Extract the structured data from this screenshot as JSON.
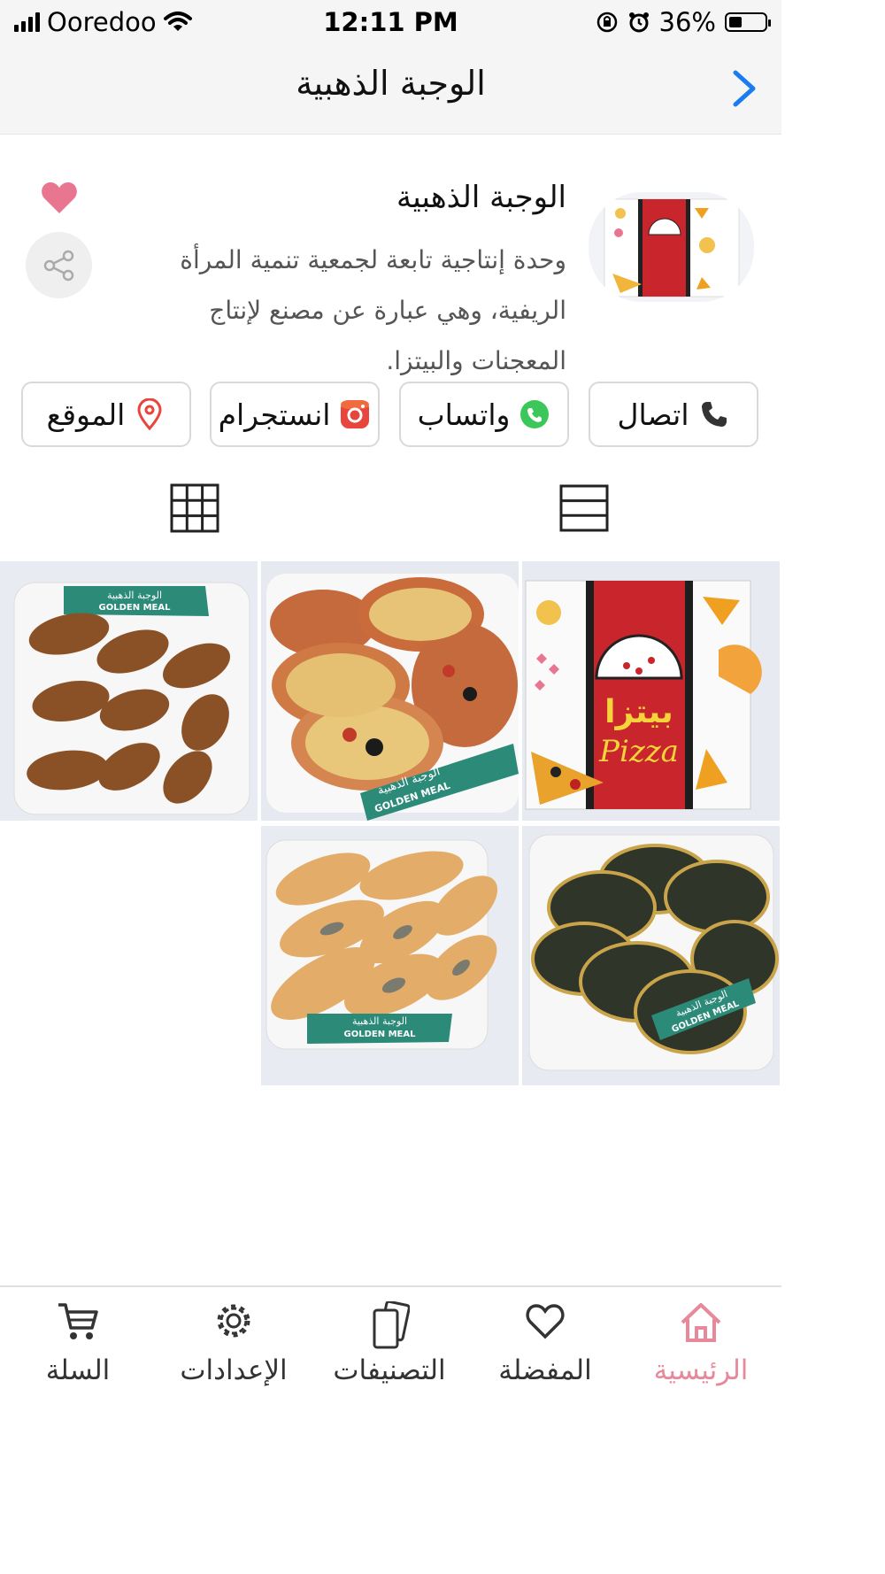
{
  "status_bar": {
    "carrier": "Ooredoo",
    "time": "12:11 PM",
    "battery": "36%"
  },
  "nav": {
    "title": "الوجبة الذهبية"
  },
  "profile": {
    "name": "الوجبة الذهبية",
    "description": "وحدة إنتاجية تابعة لجمعية تنمية المرأة الريفية، وهي عبارة عن مصنع لإنتاج المعجنات والبيتزا."
  },
  "actions": [
    {
      "label": "اتصال",
      "icon": "phone-icon"
    },
    {
      "label": "واتساب",
      "icon": "whatsapp-icon"
    },
    {
      "label": "انستجرام",
      "icon": "instagram-icon"
    },
    {
      "label": "الموقع",
      "icon": "location-pin-icon"
    }
  ],
  "grid": [
    {
      "name": "pizza-box-photo"
    },
    {
      "name": "mini-pizza-tray-photo"
    },
    {
      "name": "kibbeh-tray-photo"
    },
    {
      "name": "zaatar-manakish-tray-photo"
    },
    {
      "name": "fatayer-tray-photo"
    }
  ],
  "package_labels": {
    "arabic": "الوجبة الذهبية",
    "english": "GOLDEN MEAL"
  },
  "pizza_box_text": {
    "arabic": "بيتزا",
    "english": "Pizza"
  },
  "tabs": [
    {
      "label": "الرئيسية",
      "icon": "home-icon",
      "active": true
    },
    {
      "label": "المفضلة",
      "icon": "heart-outline-icon",
      "active": false
    },
    {
      "label": "التصنيفات",
      "icon": "categories-icon",
      "active": false
    },
    {
      "label": "الإعدادات",
      "icon": "gear-icon",
      "active": false
    },
    {
      "label": "السلة",
      "icon": "cart-icon",
      "active": false
    }
  ],
  "colors": {
    "accent_pink": "#e7899a",
    "back_blue": "#1a7cf0",
    "whatsapp_green": "#3cc75a",
    "instagram_red": "#e8453c"
  }
}
